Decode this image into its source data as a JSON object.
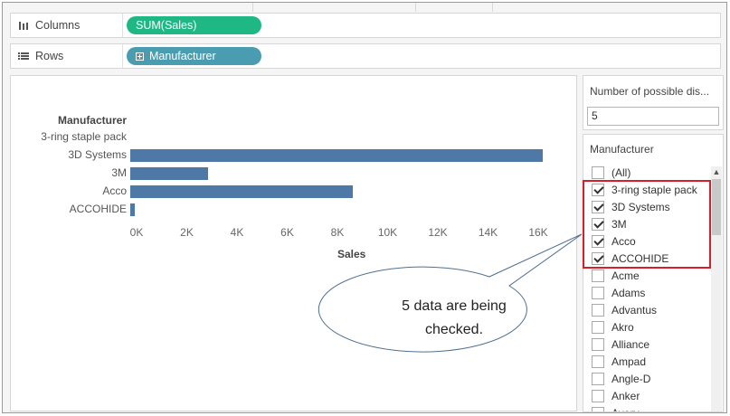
{
  "columns_shelf": {
    "label": "Columns",
    "pill": "SUM(Sales)"
  },
  "rows_shelf": {
    "label": "Rows",
    "pill": "Manufacturer"
  },
  "chart_data": {
    "type": "bar",
    "orientation": "horizontal",
    "categories": [
      "3-ring staple pack",
      "3D Systems",
      "3M",
      "Acco",
      "ACCOHIDE"
    ],
    "values": [
      0,
      16600,
      3150,
      8950,
      120
    ],
    "row_header": "Manufacturer",
    "xlabel": "Sales",
    "xticks": [
      "0K",
      "2K",
      "4K",
      "6K",
      "8K",
      "10K",
      "12K",
      "14K",
      "16K"
    ],
    "xlim": [
      0,
      16000
    ],
    "bar_color": "#4e79a7",
    "grid": false
  },
  "parameter": {
    "title": "Number of possible dis...",
    "value": "5"
  },
  "filter": {
    "title": "Manufacturer",
    "items": [
      {
        "label": "(All)",
        "checked": false
      },
      {
        "label": "3-ring staple pack",
        "checked": true
      },
      {
        "label": "3D Systems",
        "checked": true
      },
      {
        "label": "3M",
        "checked": true
      },
      {
        "label": "Acco",
        "checked": true
      },
      {
        "label": "ACCOHIDE",
        "checked": true
      },
      {
        "label": "Acme",
        "checked": false
      },
      {
        "label": "Adams",
        "checked": false
      },
      {
        "label": "Advantus",
        "checked": false
      },
      {
        "label": "Akro",
        "checked": false
      },
      {
        "label": "Alliance",
        "checked": false
      },
      {
        "label": "Ampad",
        "checked": false
      },
      {
        "label": "Angle-D",
        "checked": false
      },
      {
        "label": "Anker",
        "checked": false
      },
      {
        "label": "Avery",
        "checked": false
      }
    ]
  },
  "callout": {
    "line1": "5 data are being",
    "line2": "checked."
  },
  "colors": {
    "highlight": "#d42027",
    "sum_pill": "#1fb885",
    "dimension_pill": "#4a9db0"
  },
  "icons": {
    "columns": "columns-icon",
    "rows": "rows-icon",
    "expand": "plus-box-icon",
    "scroll": "scroll-up-icon"
  }
}
